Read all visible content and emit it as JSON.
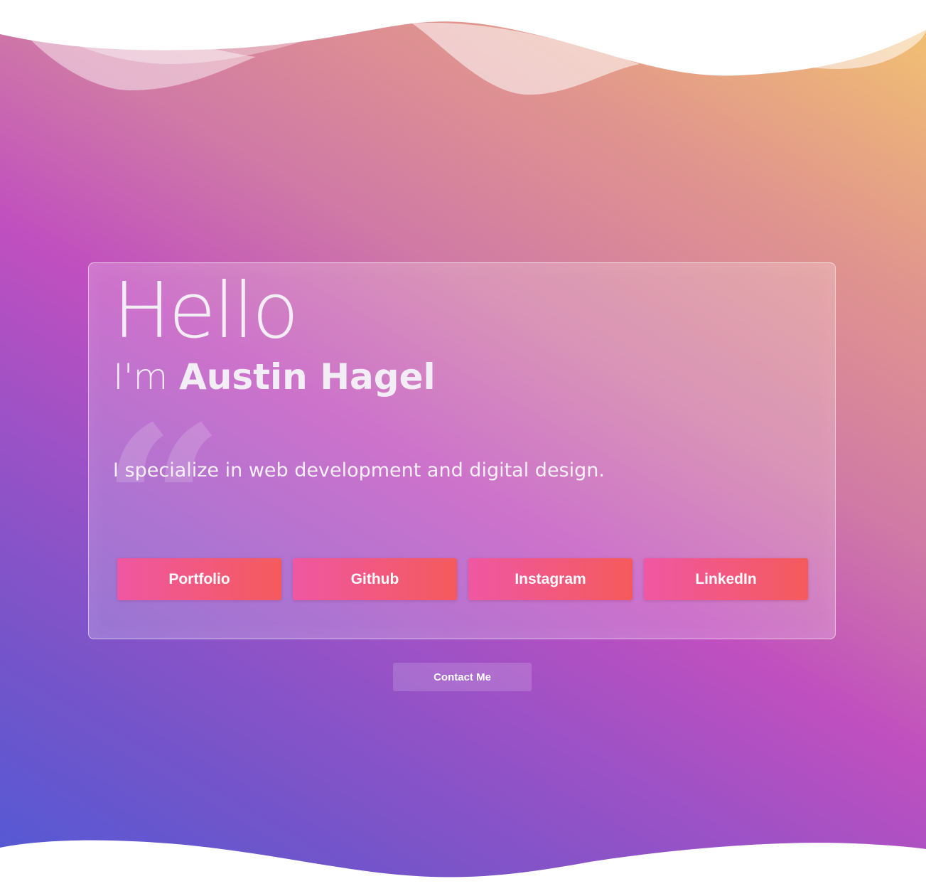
{
  "hero": {
    "hello": "Hello",
    "intro_prefix": "I'm ",
    "name": "Austin Hagel",
    "tagline": "I specialize in web development and digital design."
  },
  "links": [
    {
      "label": "Portfolio"
    },
    {
      "label": "Github"
    },
    {
      "label": "Instagram"
    },
    {
      "label": "LinkedIn"
    }
  ],
  "contact": {
    "label": "Contact Me"
  },
  "colors": {
    "gradient_blue": "#4f5ad6",
    "gradient_purple": "#c04fbf",
    "gradient_orange": "#f3c46f",
    "button_pink": "#ef57a2",
    "button_red": "#f45a5c"
  }
}
